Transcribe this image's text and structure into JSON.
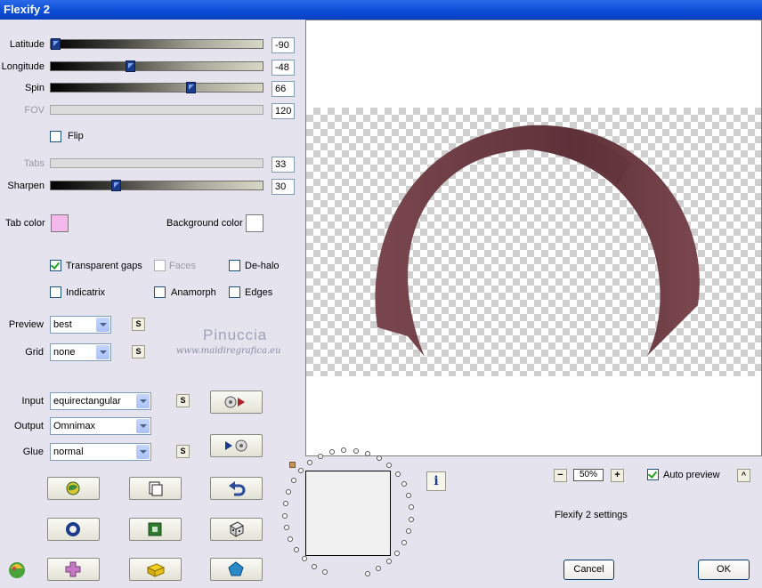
{
  "window": {
    "title": "Flexify 2"
  },
  "sliders": {
    "latitude": {
      "label": "Latitude",
      "value": "-90",
      "fraction": 0.0
    },
    "longitude": {
      "label": "Longitude",
      "value": "-48",
      "fraction": 0.37
    },
    "spin": {
      "label": "Spin",
      "value": "66",
      "fraction": 0.67
    },
    "fov": {
      "label": "FOV",
      "value": "120",
      "disabled": true
    },
    "tabs": {
      "label": "Tabs",
      "value": "33",
      "disabled": true
    },
    "sharpen": {
      "label": "Sharpen",
      "value": "30",
      "fraction": 0.3
    }
  },
  "flip": {
    "label": "Flip",
    "checked": false
  },
  "colors": {
    "tab_color_label": "Tab color",
    "tab_color": "#f5b8ea",
    "background_color_label": "Background color",
    "background_color": "#ffffff"
  },
  "options": {
    "transparent_gaps": {
      "label": "Transparent gaps",
      "checked": true
    },
    "faces": {
      "label": "Faces",
      "checked": false,
      "disabled": true
    },
    "de_halo": {
      "label": "De-halo",
      "checked": false
    },
    "indicatrix": {
      "label": "Indicatrix",
      "checked": false
    },
    "anamorph": {
      "label": "Anamorph",
      "checked": false
    },
    "edges": {
      "label": "Edges",
      "checked": false
    }
  },
  "preview_select": {
    "label": "Preview",
    "value": "best"
  },
  "grid_select": {
    "label": "Grid",
    "value": "none"
  },
  "watermark": {
    "name": "Pinuccia",
    "url": "www.maidiregrafica.eu"
  },
  "input_select": {
    "label": "Input",
    "value": "equirectangular"
  },
  "output_select": {
    "label": "Output",
    "value": "Omnimax"
  },
  "glue_select": {
    "label": "Glue",
    "value": "normal"
  },
  "small_button_label": "S",
  "zoom": {
    "value": "50%",
    "minus": "−",
    "plus": "+"
  },
  "auto_preview": {
    "label": "Auto preview",
    "checked": true
  },
  "settings_label": "Flexify 2 settings",
  "info_label": "i",
  "collapse_label": "^",
  "buttons": {
    "cancel": "Cancel",
    "ok": "OK"
  },
  "preview_colors": {
    "ring": "#7a474e",
    "ring_dark": "#5e3139"
  }
}
